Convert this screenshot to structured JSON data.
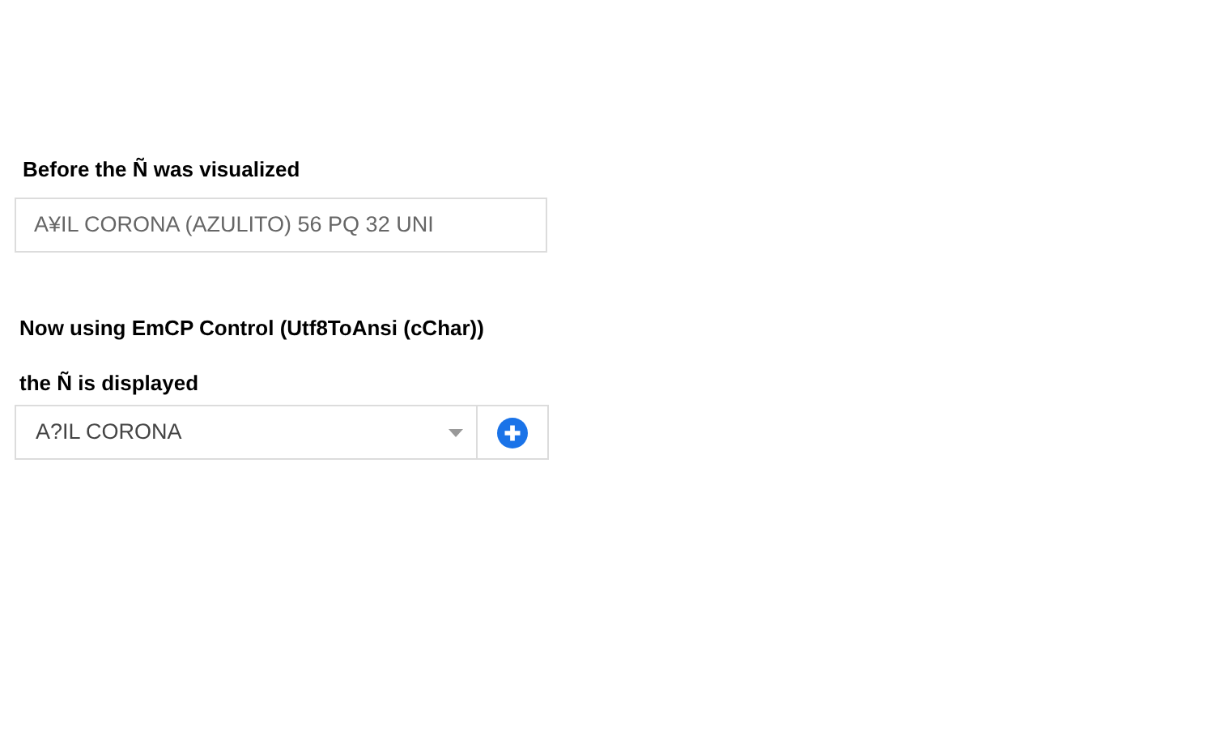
{
  "heading_1": "Before the Ñ was visualized",
  "text_field": {
    "value": "A¥IL CORONA (AZULITO) 56 PQ 32 UNI"
  },
  "heading_2": "Now using EmCP Control (Utf8ToAnsi (cChar))",
  "heading_3": "the Ñ is displayed",
  "select": {
    "value": "A?IL CORONA"
  }
}
